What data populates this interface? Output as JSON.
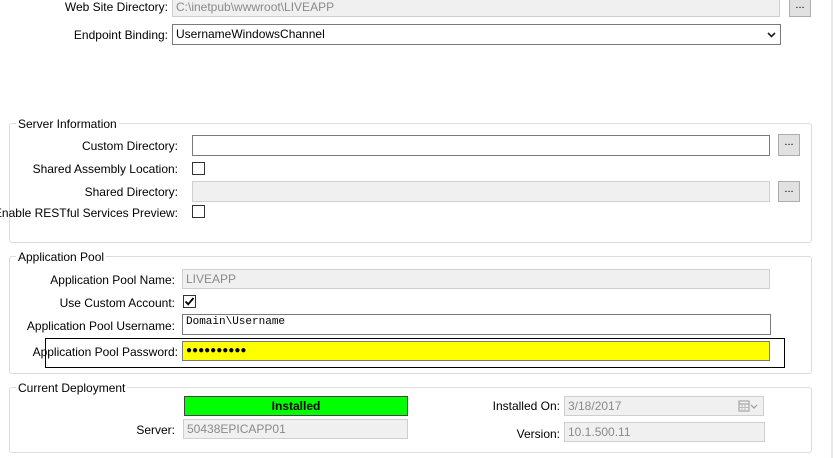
{
  "website": {
    "directory_label": "Web Site Directory:",
    "directory_value": "C:\\inetpub\\wwwroot\\LIVEAPP",
    "browse": "...",
    "binding_label": "Endpoint Binding:",
    "binding_value": "UsernameWindowsChannel"
  },
  "server_info": {
    "title": "Server Information",
    "custom_dir_label": "Custom Directory:",
    "custom_dir_value": "",
    "custom_dir_browse": "...",
    "shared_assembly_label": "Shared Assembly Location:",
    "shared_dir_label": "Shared Directory:",
    "shared_dir_value": "",
    "shared_dir_browse": "...",
    "restful_label": "Enable RESTful Services Preview:"
  },
  "app_pool": {
    "title": "Application Pool",
    "name_label": "Application Pool Name:",
    "name_value": "LIVEAPP",
    "custom_account_label": "Use Custom Account:",
    "custom_account_checked": true,
    "username_label": "Application Pool Username:",
    "username_value": "Domain\\Username",
    "password_label": "Application Pool Password:",
    "password_value": "●●●●●●●●●●",
    "highlight_color": "#ffff00"
  },
  "deployment": {
    "title": "Current Deployment",
    "status": "Installed",
    "status_color": "#00ff00",
    "server_label": "Server:",
    "server_value": "50438EPICAPP01",
    "installed_on_label": "Installed On:",
    "installed_on_value": "3/18/2017",
    "version_label": "Version:",
    "version_value": "10.1.500.11"
  }
}
